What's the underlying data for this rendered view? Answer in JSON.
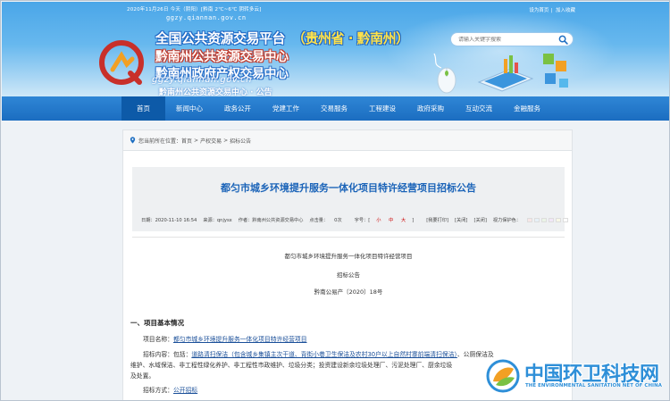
{
  "header": {
    "date_weather": "2020年11月26日 今天（阴阳）[黔南 2℃~6℃ 阴转多云]",
    "domain_small": "ggzy.qiannan.gov.cn",
    "top_links": [
      "设为首页",
      "加入收藏"
    ],
    "title_1": "全国公共资源交易平台",
    "province": "（贵州省 · 黔南州）",
    "title_2": "黔南州公共资源交易中心",
    "title_3": "黔南州政府产权交易中心",
    "domain_big": "ggzy.qiannan.gov.cn",
    "center_sub": "黔南州公共资源交易中心 · 公告"
  },
  "search": {
    "placeholder": "请输入关键字搜索"
  },
  "nav": {
    "items": [
      "首页",
      "新闻中心",
      "政务公开",
      "党建工作",
      "交易服务",
      "工程建设",
      "政府采购",
      "互动交流",
      "金融服务"
    ],
    "active_index": 0
  },
  "breadcrumb": {
    "prefix": "您当前所在位置：",
    "items": [
      "首页",
      "产权交易",
      "招标公告"
    ],
    "separator": ">"
  },
  "article": {
    "title": "都匀市城乡环境提升服务一体化项目特许经营项目招标公告",
    "meta": {
      "date": "日期：2020-11-10 16:54",
      "source": "来源：qnjysx",
      "author": "作者：黔南州公共资源交易中心",
      "clicks": "点击量：",
      "clicks_value": "0次",
      "font_label": "字号：[",
      "font_sizes": [
        "小",
        "中",
        "大"
      ],
      "font_close": "]",
      "favorite": "[我要打印]",
      "close": "[关闭]",
      "print": "[关闭]",
      "scheme_label": "视力保护色：",
      "swatches": [
        "#f7e6e6",
        "#e6f0f7",
        "#eaf4e6",
        "#f1e6f7",
        "#f7f7e6",
        "#ffffff"
      ]
    },
    "line_project": "都匀市城乡环境提升服务一体化项目特许经营项目",
    "line_notice": "招标公告",
    "line_code": "黔南公易产〔2020〕18号",
    "section_1": "一、项目基本情况",
    "project_name_label": "项目名称：",
    "project_name_value": "都匀市城乡环境提升服务一体化项目特许经营项目",
    "content_label": "招标内容：",
    "content_line_1_pre": "包括：",
    "content_line_1_u": "道路清扫保洁（包含城乡集镇主次干道、背街小巷卫生保洁及农村30户以上自然村寨前端清扫保洁）",
    "content_line_1_post": "、公厕保洁及",
    "content_line_2": "维护、水域保洁、非工程性绿化养护、非工程性市政维护、垃圾分类；投资建设新余垃圾处理厂、污泥处理厂、厨余垃圾",
    "content_line_3": "及处置。",
    "method_label": "招标方式：",
    "method_value": "公开招标"
  },
  "watermark": {
    "cn": "中国环卫科技网",
    "en": "THE ENVIRONMENTAL SANITATION NET OF CHINA"
  }
}
